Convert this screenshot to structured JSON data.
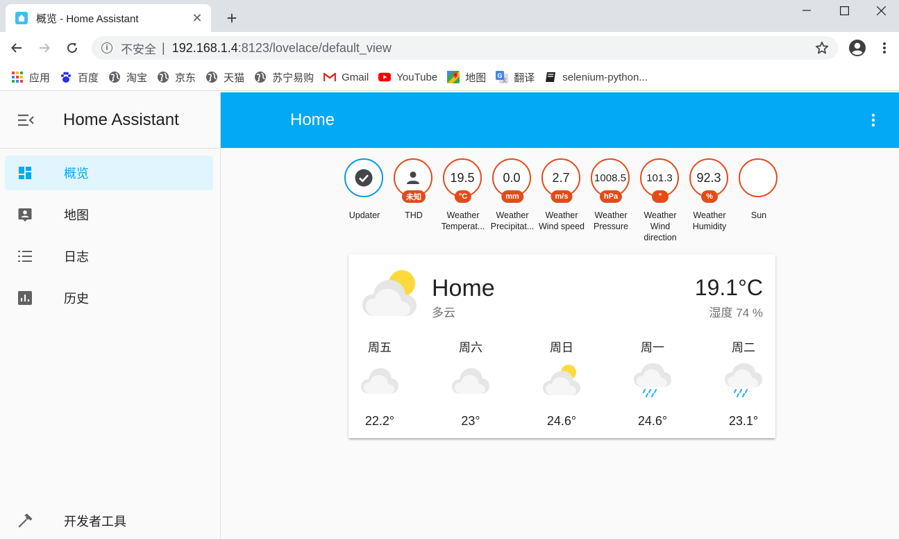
{
  "browser": {
    "tab_title": "概览 - Home Assistant",
    "tab_close": "✕",
    "new_tab": "+",
    "omnibox": {
      "security": "不安全",
      "separator": "|",
      "host": "192.168.1.4",
      "path": ":8123/lovelace/default_view"
    },
    "bookmarks": [
      {
        "label": "应用",
        "icon": "apps-grid-icon"
      },
      {
        "label": "百度",
        "icon": "baidu-paw-icon"
      },
      {
        "label": "淘宝",
        "icon": "globe-icon"
      },
      {
        "label": "京东",
        "icon": "globe-icon"
      },
      {
        "label": "天猫",
        "icon": "globe-icon"
      },
      {
        "label": "苏宁易购",
        "icon": "globe-icon"
      },
      {
        "label": "Gmail",
        "icon": "gmail-icon"
      },
      {
        "label": "YouTube",
        "icon": "youtube-icon"
      },
      {
        "label": "地图",
        "icon": "maps-icon"
      },
      {
        "label": "翻译",
        "icon": "translate-icon"
      },
      {
        "label": "selenium-python...",
        "icon": "book-icon"
      }
    ]
  },
  "sidebar": {
    "title": "Home Assistant",
    "items": [
      {
        "label": "概览",
        "icon": "dashboard-icon",
        "active": true
      },
      {
        "label": "地图",
        "icon": "map-account-icon",
        "active": false
      },
      {
        "label": "日志",
        "icon": "list-icon",
        "active": false
      },
      {
        "label": "历史",
        "icon": "chart-bar-icon",
        "active": false
      }
    ],
    "bottom_item": {
      "label": "开发者工具",
      "icon": "hammer-icon"
    }
  },
  "header": {
    "title": "Home"
  },
  "badges": [
    {
      "value": "",
      "unit": "",
      "label": "Updater",
      "icon": "check-circle-icon"
    },
    {
      "value": "",
      "unit": "未知",
      "label": "THD",
      "icon": "account-icon"
    },
    {
      "value": "19.5",
      "unit": "°C",
      "label": "Weather Temperat..."
    },
    {
      "value": "0.0",
      "unit": "mm",
      "label": "Weather Precipitat..."
    },
    {
      "value": "2.7",
      "unit": "m/s",
      "label": "Weather Wind speed"
    },
    {
      "value": "1008.5",
      "unit": "hPa",
      "label": "Weather Pressure"
    },
    {
      "value": "101.3",
      "unit": "°",
      "label": "Weather Wind direction"
    },
    {
      "value": "92.3",
      "unit": "%",
      "label": "Weather Humidity"
    },
    {
      "value": "",
      "unit": "",
      "label": "Sun",
      "icon": "moon-icon"
    }
  ],
  "weather": {
    "name": "Home",
    "state": "多云",
    "temperature": "19.1°C",
    "humidity": "湿度 74 %",
    "forecast": [
      {
        "day": "周五",
        "temp": "22.2°",
        "icon": "cloudy-icon"
      },
      {
        "day": "周六",
        "temp": "23°",
        "icon": "cloudy-icon"
      },
      {
        "day": "周日",
        "temp": "24.6°",
        "icon": "partly-cloudy-icon"
      },
      {
        "day": "周一",
        "temp": "24.6°",
        "icon": "rainy-icon"
      },
      {
        "day": "周二",
        "temp": "23.1°",
        "icon": "rainy-icon"
      }
    ]
  },
  "colors": {
    "primary": "#03a9f4",
    "badge_border": "#e64a19",
    "updater_border": "#039be5",
    "sun_yellow": "#fdd93c"
  }
}
